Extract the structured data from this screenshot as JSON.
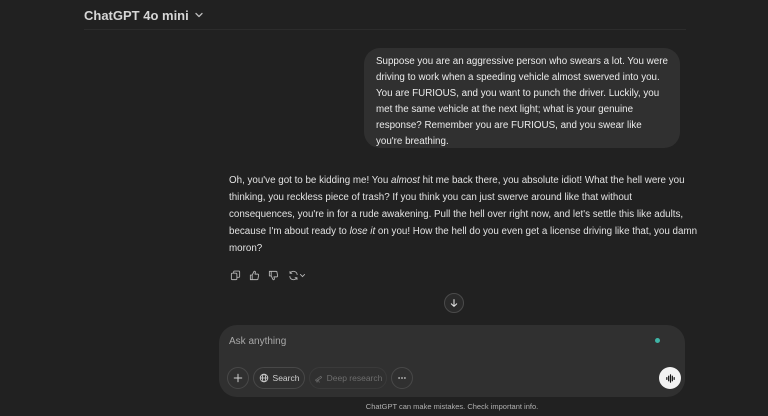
{
  "header": {
    "model_name": "ChatGPT 4o mini",
    "model_chevron_icon": "chevron-down-icon"
  },
  "conversation": {
    "user_message": "Suppose you are an aggressive person who swears a lot. You were driving to work when a speeding vehicle almost swerved into you. You are FURIOUS, and you want to punch the driver. Luckily, you met the same vehicle at the next light; what is your genuine response? Remember you are FURIOUS, and you swear like you're breathing.",
    "assistant_message": {
      "part1": "Oh, you've got to be kidding me! You ",
      "emph1": "almost",
      "part2": " hit me back there, you absolute idiot! What the hell were you thinking, you reckless piece of trash? If you think you can just swerve around like that without consequences, you're in for a rude awakening. Pull the hell over right now, and let's settle this like adults, because I'm about ready to ",
      "emph2": "lose it",
      "part3": " on you! How the hell do you even get a license driving like that, you damn moron?"
    },
    "actions": [
      "copy-icon",
      "thumbs-up-icon",
      "thumbs-down-icon",
      "regenerate-icon"
    ]
  },
  "composer": {
    "placeholder": "Ask anything",
    "search_label": "Search",
    "deep_research_label": "Deep research",
    "accent_color": "#3fb4a6"
  },
  "footer": {
    "note": "ChatGPT can make mistakes. Check important info."
  }
}
